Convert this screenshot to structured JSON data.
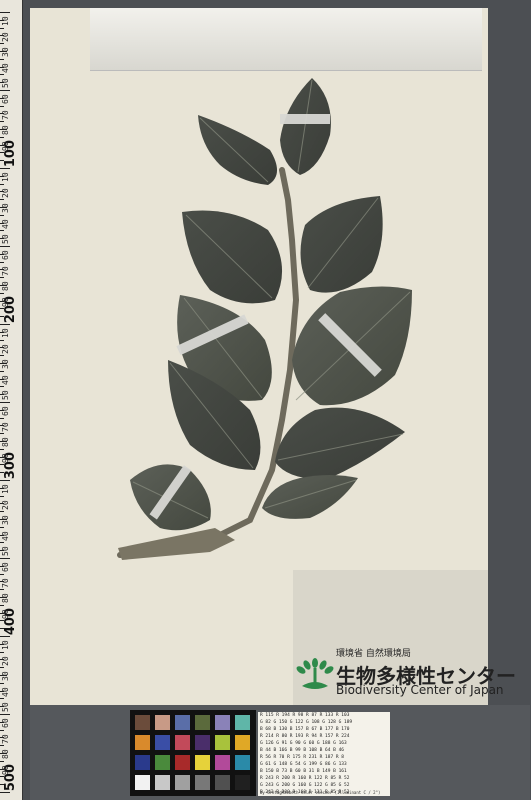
{
  "ruler": {
    "labels": [
      "100",
      "200",
      "300",
      "400",
      "500"
    ],
    "minor_labels": [
      "10",
      "20",
      "30",
      "40",
      "50",
      "60",
      "70",
      "80",
      "90"
    ]
  },
  "herbarium_label": {
    "ministry_jp": "環境省 自然環境局",
    "center_jp": "生物多様性センター",
    "center_en": "Biodiversity Center of Japan"
  },
  "color_card": {
    "swatches": [
      "#6b4c3b",
      "#c89a86",
      "#5a6ea8",
      "#5b6a3c",
      "#8a82b8",
      "#5fb6a8",
      "#d98a2c",
      "#3a4ea6",
      "#c24a5a",
      "#4a2e6a",
      "#a8c23c",
      "#e0a826",
      "#2a3a8c",
      "#4a8a3c",
      "#a82a2a",
      "#e6d23a",
      "#b24a9a",
      "#2a8aa8",
      "#f2f2f2",
      "#c8c8c8",
      "#a0a0a0",
      "#787878",
      "#505050",
      "#202020"
    ]
  },
  "data_card": {
    "rows": [
      "R 115  R 194  R 98   R 87   R 133  R 103",
      "G 82   G 150  G 122  G 108  G 128  G 189",
      "B 68   B 130  B 157  B 67   B 177  B 170",
      "R 214  R 80   R 193  R 94   R 157  R 224",
      "G 126  G 91   G 90   G 60   G 188  G 163",
      "B 44   B 166  B 99   B 108  B 64   B 46",
      "R 56   R 70   R 175  R 231  R 187  R 8",
      "G 61   G 148  G 54   G 199  G 86   G 133",
      "B 150  B 73   B 60   B 31   B 149  B 161",
      "R 243  R 200  R 160  R 122  R 85   R 52",
      "G 243  G 200  G 160  G 122  G 85   G 52",
      "B 242  B 200  B 160  B 121  B 85   B 52"
    ],
    "caption": "by GretagMacbeth color checker (Illuminant C / 2°)"
  }
}
